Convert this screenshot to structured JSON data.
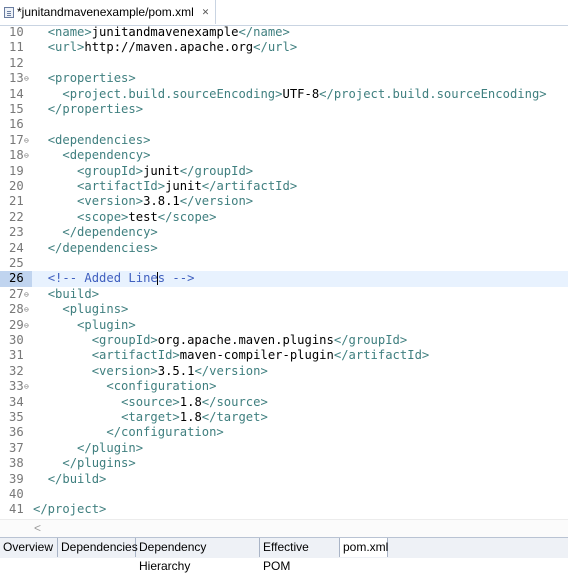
{
  "editor_tab": {
    "title": "*junitandmavenexample/pom.xml",
    "close_symbol": "✕"
  },
  "lines": [
    {
      "n": "10",
      "code": "  <name>junitandmavenexample</name>"
    },
    {
      "n": "11",
      "code": "  <url>http://maven.apache.org</url>"
    },
    {
      "n": "12",
      "code": ""
    },
    {
      "n": "13",
      "code": "  <properties>",
      "fold": true
    },
    {
      "n": "14",
      "code": "    <project.build.sourceEncoding>UTF-8</project.build.sourceEncoding>"
    },
    {
      "n": "15",
      "code": "  </properties>"
    },
    {
      "n": "16",
      "code": ""
    },
    {
      "n": "17",
      "code": "  <dependencies>",
      "fold": true
    },
    {
      "n": "18",
      "code": "    <dependency>",
      "fold": true
    },
    {
      "n": "19",
      "code": "      <groupId>junit</groupId>"
    },
    {
      "n": "20",
      "code": "      <artifactId>junit</artifactId>"
    },
    {
      "n": "21",
      "code": "      <version>3.8.1</version>"
    },
    {
      "n": "22",
      "code": "      <scope>test</scope>"
    },
    {
      "n": "23",
      "code": "    </dependency>"
    },
    {
      "n": "24",
      "code": "  </dependencies>"
    },
    {
      "n": "25",
      "code": ""
    },
    {
      "n": "26",
      "code": "  <!-- Added Lines -->",
      "current": true
    },
    {
      "n": "27",
      "code": "  <build>",
      "fold": true
    },
    {
      "n": "28",
      "code": "    <plugins>",
      "fold": true
    },
    {
      "n": "29",
      "code": "      <plugin>",
      "fold": true
    },
    {
      "n": "30",
      "code": "        <groupId>org.apache.maven.plugins</groupId>"
    },
    {
      "n": "31",
      "code": "        <artifactId>maven-compiler-plugin</artifactId>"
    },
    {
      "n": "32",
      "code": "        <version>3.5.1</version>"
    },
    {
      "n": "33",
      "code": "          <configuration>",
      "fold": true
    },
    {
      "n": "34",
      "code": "            <source>1.8</source>"
    },
    {
      "n": "35",
      "code": "            <target>1.8</target>"
    },
    {
      "n": "36",
      "code": "          </configuration>"
    },
    {
      "n": "37",
      "code": "      </plugin>"
    },
    {
      "n": "38",
      "code": "    </plugins>"
    },
    {
      "n": "39",
      "code": "  </build>"
    },
    {
      "n": "40",
      "code": ""
    },
    {
      "n": "41",
      "code": "</project>"
    }
  ],
  "caret": {
    "line": "26",
    "column": 17
  },
  "hscroll": {
    "left_arrow": "<"
  },
  "page_tabs": [
    {
      "label": "Overview"
    },
    {
      "label": "Dependencies"
    },
    {
      "label": "Dependency Hierarchy"
    },
    {
      "label": "Effective POM"
    },
    {
      "label": "pom.xml",
      "selected": true
    }
  ],
  "colors": {
    "tag": "#3f7f7f",
    "comment": "#3f5fbf",
    "current_line": "#e8f2fe",
    "line_number": "#787878"
  }
}
